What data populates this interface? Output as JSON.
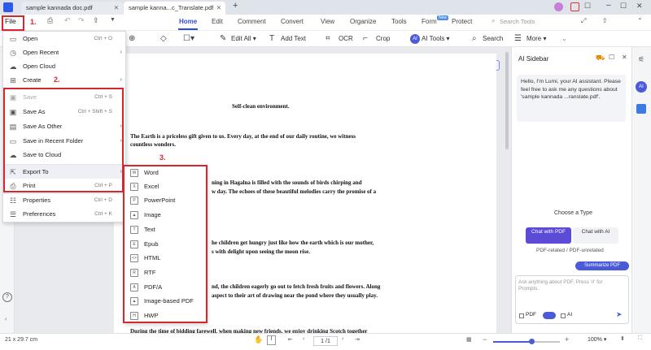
{
  "tabs": [
    {
      "label": "sample kannada doc.pdf",
      "active": false
    },
    {
      "label": "sample kanna...c_Translate.pdf",
      "active": true
    }
  ],
  "menubar": {
    "file": "File",
    "items": [
      "Home",
      "Edit",
      "Comment",
      "Convert",
      "View",
      "Organize",
      "Tools",
      "Form",
      "Protect"
    ],
    "new_badge": "New",
    "search_placeholder": "Search Tools"
  },
  "toolbar": {
    "edit_all": "Edit All",
    "add_text": "Add Text",
    "ocr": "OCR",
    "crop": "Crop",
    "ai_tools": "AI Tools",
    "search": "Search",
    "more": "More"
  },
  "file_menu": {
    "items": [
      {
        "label": "Open",
        "shortcut": "Ctrl + O",
        "icon": "folder-open-icon",
        "arrow": false,
        "disabled": false
      },
      {
        "label": "Open Recent",
        "shortcut": "",
        "icon": "clock-icon",
        "arrow": true,
        "disabled": false
      },
      {
        "label": "Open Cloud",
        "shortcut": "",
        "icon": "cloud-icon",
        "arrow": false,
        "disabled": false
      },
      {
        "label": "Create",
        "shortcut": "",
        "icon": "plus-box-icon",
        "arrow": true,
        "disabled": false
      },
      {
        "label": "Save",
        "shortcut": "Ctrl + S",
        "icon": "save-icon",
        "arrow": false,
        "disabled": true
      },
      {
        "label": "Save As",
        "shortcut": "Ctrl + Shift + S",
        "icon": "save-as-icon",
        "arrow": false,
        "disabled": false
      },
      {
        "label": "Save As Other",
        "shortcut": "",
        "icon": "save-other-icon",
        "arrow": true,
        "disabled": false
      },
      {
        "label": "Save in Recent Folder",
        "shortcut": "",
        "icon": "recent-folder-icon",
        "arrow": true,
        "disabled": false
      },
      {
        "label": "Save to Cloud",
        "shortcut": "",
        "icon": "cloud-upload-icon",
        "arrow": false,
        "disabled": false
      },
      {
        "label": "Export To",
        "shortcut": "",
        "icon": "export-icon",
        "arrow": true,
        "disabled": false
      },
      {
        "label": "Print",
        "shortcut": "Ctrl + P",
        "icon": "printer-icon",
        "arrow": false,
        "disabled": false
      },
      {
        "label": "Properties",
        "shortcut": "Ctrl + D",
        "icon": "properties-icon",
        "arrow": false,
        "disabled": false
      },
      {
        "label": "Preferences",
        "shortcut": "Ctrl + K",
        "icon": "preferences-icon",
        "arrow": false,
        "disabled": false
      }
    ]
  },
  "export_submenu": [
    "Word",
    "Excel",
    "PowerPoint",
    "Image",
    "Text",
    "Epub",
    "HTML",
    "RTF",
    "PDF/A",
    "Image-based PDF",
    "HWP"
  ],
  "annotations": {
    "step1": "1.",
    "step2": "2.",
    "step3": "3."
  },
  "document": {
    "heading": "Self-clean environment.",
    "lines": [
      "The Earth is a priceless gift given to us. Every day, at the end of our daily routine, we witness",
      "countless wonders.",
      "ning  in  Hagalna  is  filled  with  the  sounds  of  birds  chirping  and",
      "w day. The echoes of these beautiful melodies carry the promise of a",
      "he children get hungry just like how the earth which is our mother,",
      "s with delight upon seeing the moon rise.",
      "nd, the children eagerly go out to fetch fresh fruits and flowers. Along",
      "aspect to their art of drawing near the pond where they usually play.",
      "During the time of bidding farewell, when making new friends, we enjoy drinking Scotch together"
    ]
  },
  "ai_sidebar": {
    "title": "AI Sidebar",
    "greeting": "Hello, I'm Lumi, your AI assistant. Please feel free to ask me any questions about 'sample kannada ...ranslate.pdf'.",
    "choose_type": "Choose a Type",
    "chat_pdf": "Chat with PDF",
    "chat_ai": "Chat with AI",
    "subtitle": "PDF-related / PDF-unrelated",
    "summarize": "Summarize PDF",
    "input_placeholder": "Ask anything about PDF. Press '#' for Prompts.",
    "pdf_label": "PDF",
    "ai_label": "AI"
  },
  "status": {
    "page_size": "21 x 29.7 cm",
    "page_indicator": "1 /1",
    "zoom": "100%"
  },
  "colors": {
    "accent": "#4b5bd8",
    "annotation_red": "#d4282e",
    "chat_pdf_bg": "#5b4bd6"
  }
}
